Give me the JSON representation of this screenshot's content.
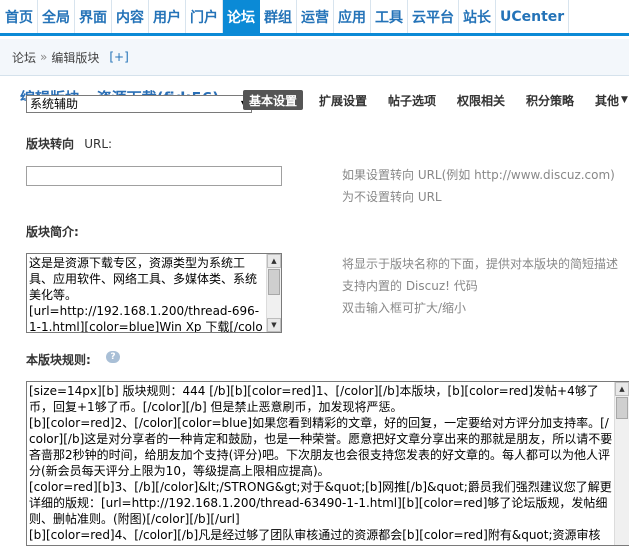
{
  "nav": {
    "items": [
      "首页",
      "全局",
      "界面",
      "内容",
      "用户",
      "门户",
      "论坛",
      "群组",
      "运营",
      "应用",
      "工具",
      "云平台",
      "站长",
      "UCenter"
    ],
    "active_index": 6
  },
  "breadcrumb": {
    "root": "论坛",
    "separator": "»",
    "current": "编辑版块",
    "add": "[+]"
  },
  "forum_select": {
    "title_behind": "编辑版块 - 资源下载(fid:56)",
    "selected": "系统辅助"
  },
  "tabs": [
    {
      "label": "基本设置",
      "active": true
    },
    {
      "label": "扩展设置",
      "active": false
    },
    {
      "label": "帖子选项",
      "active": false
    },
    {
      "label": "权限相关",
      "active": false
    },
    {
      "label": "积分策略",
      "active": false
    },
    {
      "label": "其他",
      "active": false
    }
  ],
  "redirect": {
    "label": "版块转向",
    "label_suffix": "URL:",
    "value": "",
    "hint_line1": "如果设置转向 URL(例如 http://www.discuz.com)",
    "hint_line2": "为不设置转向 URL"
  },
  "description": {
    "label": "版块简介:",
    "text": "这是是资源下载专区，资源类型为系统工具、应用软件、网络工具、多媒体类、系统美化等。\n[url=http://192.168.1.200/thread-696-1-1.html][color=blue]Win Xp 下载[/color][/url]",
    "hint_line1": "将显示于版块名称的下面，提供对本版块的简短描述",
    "hint_line2": "支持内置的 Discuz! 代码",
    "hint_line3": "双击输入框可扩大/缩小"
  },
  "rules": {
    "label": "本版块规则:",
    "text": "[size=14px][b] 版块规则：444 [/b][b][color=red]1、[/color][/b]本版块，[b][color=red]发帖+4够了币，回复+1够了币。[/color][/b] 但是禁止恶意刷币，加发现将严惩。\n[b][color=red]2、[/color][color=blue]如果您看到精彩的文章，好的回复，一定要给对方评分加支持率。[/color][/b]这是对分享者的一种肯定和鼓励，也是一种荣誉。愿意把好文章分享出来的那就是朋友，所以请不要吝啬那2秒钟的时间，给朋友加个支持(评分)吧。下次朋友也会很支持您发表的好文章的。每人都可以为他人评分(新会员每天评分上限为10，等级提高上限相应提高)。\n[color=red][b]3、[/b][/color]&lt;/STRONG&gt;对于&quot;[b]网推[/b]&quot;爵员我们强烈建议您了解更详细的版规：[url=http://192.168.1.200/thread-63490-1-1.html][b][color=red]够了论坛版规，发帖细则、删帖准则。(附图)[/color][/b][/url]\n[b][color=red]4、[/color][/b]凡是经过够了团队审核通过的资源都会[b][color=red]附有&quot;资源审核"
  }
}
